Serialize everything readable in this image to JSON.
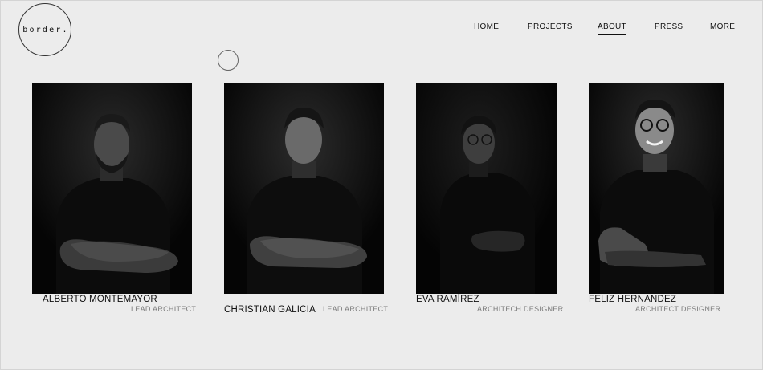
{
  "site": {
    "logo_text": "border."
  },
  "nav": {
    "items": [
      {
        "label": "HOME"
      },
      {
        "label": "PROJECTS"
      },
      {
        "label": "ABOUT",
        "active": true
      },
      {
        "label": "PRESS"
      },
      {
        "label": "MORE"
      }
    ]
  },
  "team": [
    {
      "name": "ALBERTO MONTEMAYOR",
      "role": "LEAD ARCHITECT"
    },
    {
      "name": "CHRISTIAN GALICIA",
      "role": "LEAD ARCHITECT"
    },
    {
      "name": "EVA RAMÍREZ",
      "role": "ARCHITECH DESIGNER"
    },
    {
      "name": "FELIZ HERNANDEZ",
      "role": "ARCHITECT DESIGNER"
    }
  ],
  "colors": {
    "background": "#ececec",
    "text": "#111111",
    "muted": "#7a7a7a",
    "photo_bg": "#050505"
  }
}
